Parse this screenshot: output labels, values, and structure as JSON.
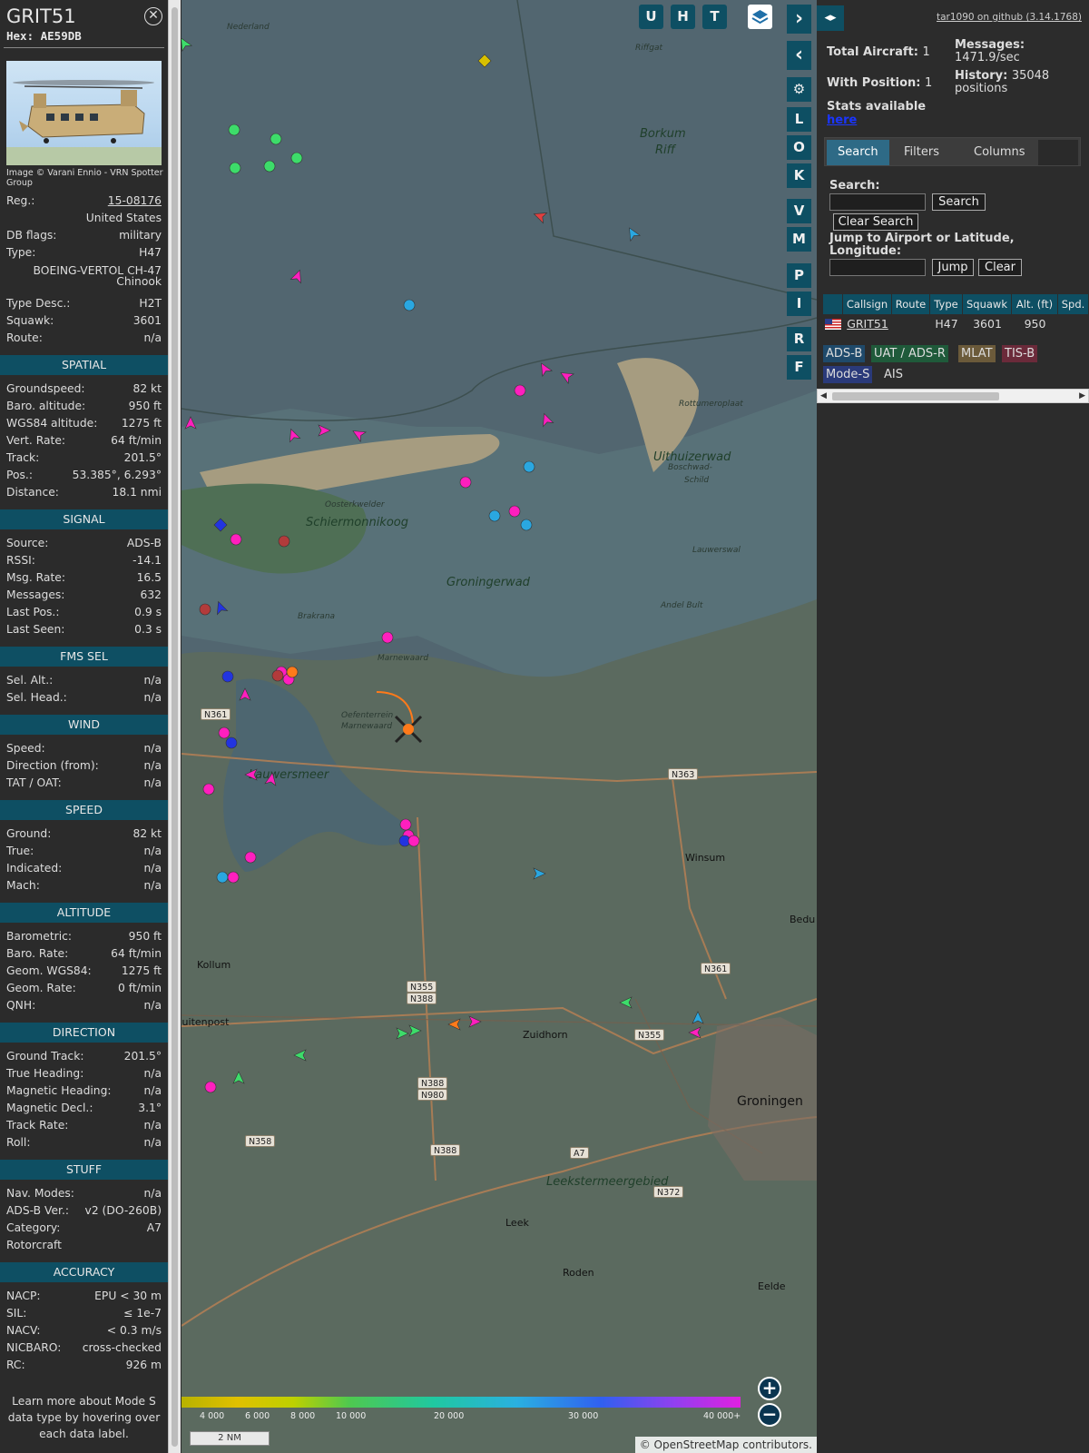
{
  "selected": {
    "callsign": "GRIT51",
    "hex_label": "Hex: AE59DB",
    "photo_credit": "Image © Varani Ennio - VRN Spotter Group",
    "top_rows": [
      {
        "k": "Reg.:",
        "v": "15-08176"
      },
      {
        "k": "",
        "v": "United States"
      },
      {
        "k": "DB flags:",
        "v": "military"
      },
      {
        "k": "Type:",
        "v": "H47"
      }
    ],
    "type_long": [
      "BOEING-VERTOL CH-47",
      "Chinook"
    ],
    "top_rows2": [
      {
        "k": "Type Desc.:",
        "v": "H2T"
      },
      {
        "k": "Squawk:",
        "v": "3601"
      },
      {
        "k": "Route:",
        "v": "n/a"
      }
    ],
    "sections": [
      {
        "title": "SPATIAL",
        "rows": [
          {
            "k": "Groundspeed:",
            "v": "82 kt"
          },
          {
            "k": "Baro. altitude:",
            "v": "950 ft"
          },
          {
            "k": "WGS84 altitude:",
            "v": "1275 ft"
          },
          {
            "k": "Vert. Rate:",
            "v": "64 ft/min"
          },
          {
            "k": "Track:",
            "v": "201.5°"
          },
          {
            "k": "Pos.:",
            "v": "53.385°, 6.293°"
          },
          {
            "k": "Distance:",
            "v": "18.1 nmi"
          }
        ]
      },
      {
        "title": "SIGNAL",
        "rows": [
          {
            "k": "Source:",
            "v": "ADS-B"
          },
          {
            "k": "RSSI:",
            "v": "-14.1"
          },
          {
            "k": "Msg. Rate:",
            "v": "16.5"
          },
          {
            "k": "Messages:",
            "v": "632"
          },
          {
            "k": "Last Pos.:",
            "v": "0.9 s"
          },
          {
            "k": "Last Seen:",
            "v": "0.3 s"
          }
        ]
      },
      {
        "title": "FMS SEL",
        "rows": [
          {
            "k": "Sel. Alt.:",
            "v": "n/a"
          },
          {
            "k": "Sel. Head.:",
            "v": "n/a"
          }
        ]
      },
      {
        "title": "WIND",
        "rows": [
          {
            "k": "Speed:",
            "v": "n/a"
          },
          {
            "k": "Direction (from):",
            "v": "n/a"
          },
          {
            "k": "TAT / OAT:",
            "v": "n/a"
          }
        ]
      },
      {
        "title": "SPEED",
        "rows": [
          {
            "k": "Ground:",
            "v": "82 kt"
          },
          {
            "k": "True:",
            "v": "n/a"
          },
          {
            "k": "Indicated:",
            "v": "n/a"
          },
          {
            "k": "Mach:",
            "v": "n/a"
          }
        ]
      },
      {
        "title": "ALTITUDE",
        "rows": [
          {
            "k": "Barometric:",
            "v": "950 ft"
          },
          {
            "k": "Baro. Rate:",
            "v": "64 ft/min"
          },
          {
            "k": "Geom. WGS84:",
            "v": "1275 ft"
          },
          {
            "k": "Geom. Rate:",
            "v": "0 ft/min"
          },
          {
            "k": "QNH:",
            "v": "n/a"
          }
        ]
      },
      {
        "title": "DIRECTION",
        "rows": [
          {
            "k": "Ground Track:",
            "v": "201.5°"
          },
          {
            "k": "True Heading:",
            "v": "n/a"
          },
          {
            "k": "Magnetic Heading:",
            "v": "n/a"
          },
          {
            "k": "Magnetic Decl.:",
            "v": "3.1°"
          },
          {
            "k": "Track Rate:",
            "v": "n/a"
          },
          {
            "k": "Roll:",
            "v": "n/a"
          }
        ]
      },
      {
        "title": "STUFF",
        "rows": [
          {
            "k": "Nav. Modes:",
            "v": "n/a"
          },
          {
            "k": "ADS-B Ver.:",
            "v": "v2 (DO-260B)"
          },
          {
            "k": "Category:",
            "v": "A7"
          },
          {
            "k": "Rotorcraft",
            "v": ""
          }
        ]
      },
      {
        "title": "ACCURACY",
        "rows": [
          {
            "k": "NACP:",
            "v": "EPU < 30 m"
          },
          {
            "k": "SIL:",
            "v": "≤ 1e-7"
          },
          {
            "k": "NACV:",
            "v": "< 0.3 m/s"
          },
          {
            "k": "NICBARO:",
            "v": "cross-checked"
          },
          {
            "k": "RC:",
            "v": "926 m"
          }
        ]
      }
    ],
    "footnote": "Learn more about Mode S data type by hovering over each data label."
  },
  "map": {
    "top_buttons": [
      "U",
      "H",
      "T"
    ],
    "side_buttons": [
      "L",
      "O",
      "K",
      "V",
      "M",
      "P",
      "I",
      "R",
      "F"
    ],
    "place_labels": [
      {
        "text": "Nederland"
      },
      {
        "text": "Riffgat"
      },
      {
        "text": "Borkum"
      },
      {
        "text": "Riff"
      },
      {
        "text": "Rottumeroplaat"
      },
      {
        "text": "Uithuizerwad"
      },
      {
        "text": "Boschwad-"
      },
      {
        "text": "Schild"
      },
      {
        "text": "Schiermonnikoog"
      },
      {
        "text": "Oosterkwelder"
      },
      {
        "text": "Groningerwad"
      },
      {
        "text": "Brakrana"
      },
      {
        "text": "Marnewaard"
      },
      {
        "text": "Oefenterrein"
      },
      {
        "text": "Marnewaard"
      },
      {
        "text": "Lauwersmeer"
      },
      {
        "text": "Winsum"
      },
      {
        "text": "Kollum"
      },
      {
        "text": "Buitenpost"
      },
      {
        "text": "Zuidhorn"
      },
      {
        "text": "Groningen"
      },
      {
        "text": "Leek"
      },
      {
        "text": "Roden"
      },
      {
        "text": "Eelde"
      },
      {
        "text": "Leekstermeergebied"
      },
      {
        "text": "Bedu"
      },
      {
        "text": "Lauwerswal"
      },
      {
        "text": "Andel Bult"
      }
    ],
    "road_shields": [
      "N361",
      "N363",
      "N361",
      "N355",
      "N388",
      "N355",
      "N388",
      "N980",
      "N358",
      "N388",
      "A7",
      "N372"
    ],
    "altitude_scale": [
      "4 000",
      "6 000",
      "8 000",
      "10 000",
      "20 000",
      "30 000",
      "40 000+"
    ],
    "scale_label": "2 NM",
    "attribution": "© OpenStreetMap contributors."
  },
  "right": {
    "github_link": "tar1090 on github (3.14.1768)",
    "total_aircraft": {
      "label": "Total Aircraft:",
      "value": "1"
    },
    "with_position": {
      "label": "With Position:",
      "value": "1"
    },
    "messages": {
      "label": "Messages:",
      "value": "1471.9/sec"
    },
    "history": {
      "label": "History:",
      "value": "35048",
      "unit": "positions"
    },
    "stats_label": "Stats available",
    "stats_link": "here",
    "tabs": [
      "Search",
      "Filters",
      "Columns"
    ],
    "search_label": "Search:",
    "search_button": "Search",
    "clear_search_button": "Clear Search",
    "jump_label": "Jump to Airport or Latitude, Longitude:",
    "jump_button": "Jump",
    "clear_button": "Clear",
    "columns": [
      "Callsign",
      "Route",
      "Type",
      "Squawk",
      "Alt. (ft)",
      "Spd."
    ],
    "row": {
      "callsign": "GRIT51",
      "route": "",
      "type": "H47",
      "squawk": "3601",
      "alt": "950"
    },
    "legend": [
      {
        "label": "ADS-B",
        "bg": "#1f4a6b"
      },
      {
        "label": "UAT / ADS-R",
        "bg": "#1f5a3a"
      },
      {
        "label": "MLAT",
        "bg": "#6b5a3a"
      },
      {
        "label": "TIS-B",
        "bg": "#6b2a3a"
      },
      {
        "label": "Mode-S",
        "bg": "#2a3a7a"
      },
      {
        "label": "AIS",
        "bg": ""
      }
    ]
  }
}
